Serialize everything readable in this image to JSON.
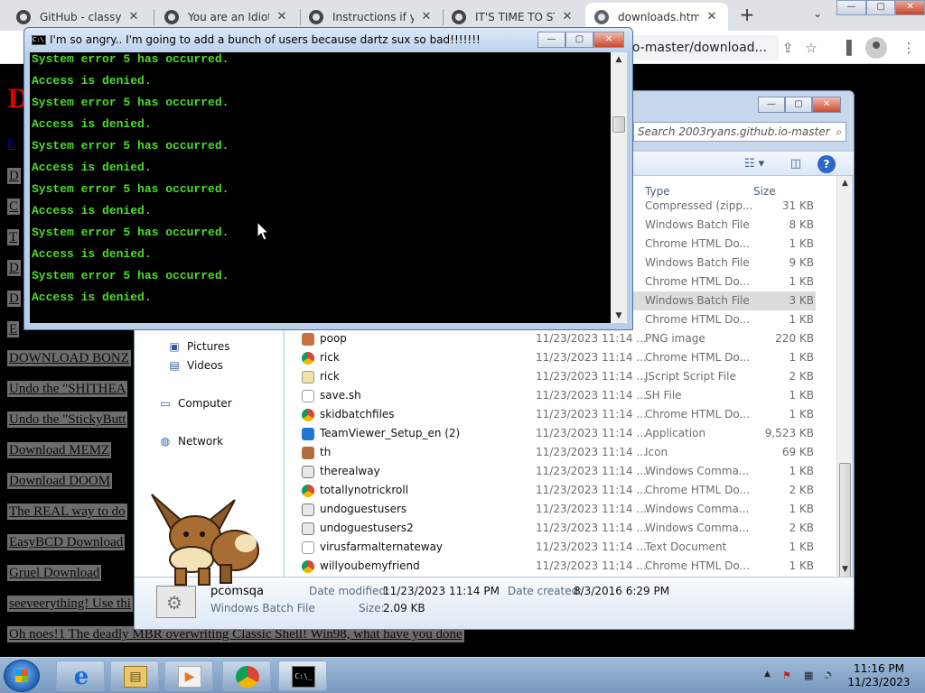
{
  "browser": {
    "tabs": [
      {
        "title": "GitHub - classyjak"
      },
      {
        "title": "You are an Idiot! ("
      },
      {
        "title": "Instructions if you"
      },
      {
        "title": "IT'S TIME TO STOP"
      },
      {
        "title": "downloads.html"
      }
    ],
    "new_tab": "+",
    "tab_search": "⌄",
    "url": "io-master/download...",
    "window_buttons": {
      "minimize": "—",
      "maximize": "▢",
      "close": "✕"
    }
  },
  "page": {
    "heading": "D",
    "small_link": "E",
    "links": [
      {
        "text": "D"
      },
      {
        "text": "C"
      },
      {
        "text": "T"
      },
      {
        "text": "D"
      },
      {
        "text": "D"
      },
      {
        "text": "E"
      },
      {
        "text": "DOWNLOAD BONZ"
      },
      {
        "text": "Undo the \"SHITHEA"
      },
      {
        "text": "Undo the \"StickyButt"
      },
      {
        "text": "Download MEMZ"
      },
      {
        "text": "Download DOOM"
      },
      {
        "text": "The REAL way to do"
      },
      {
        "text": "EasyBCD Download"
      },
      {
        "text": "Gruel Download"
      },
      {
        "text": "seeveerything! Use thi"
      },
      {
        "text": "Oh noes!1 The deadly MBR overwriting Classic Shell! Win98, what have you done"
      }
    ]
  },
  "explorer": {
    "search_placeholder": "Search 2003ryans.github.io-master",
    "columns": {
      "type": "Type",
      "size": "Size"
    },
    "nav": [
      {
        "label": "Pictures",
        "glyph": "▣"
      },
      {
        "label": "Videos",
        "glyph": "▤"
      },
      {
        "label": "Computer",
        "glyph": "▭"
      },
      {
        "label": "Network",
        "glyph": "◍"
      }
    ],
    "top_rows": [
      {
        "type": "Compressed (zipp...",
        "size": "31 KB",
        "icon": "ic-zip"
      },
      {
        "type": "Windows Batch File",
        "size": "8 KB",
        "icon": "ic-bat"
      },
      {
        "type": "Chrome HTML Do...",
        "size": "1 KB",
        "icon": "ic-chrome"
      },
      {
        "type": "Windows Batch File",
        "size": "9 KB",
        "icon": "ic-bat"
      },
      {
        "type": "Chrome HTML Do...",
        "size": "1 KB",
        "icon": "ic-chrome"
      },
      {
        "type": "Windows Batch File",
        "size": "3 KB",
        "icon": "ic-bat",
        "selected": true
      },
      {
        "type": "Chrome HTML Do...",
        "size": "1 KB",
        "icon": "ic-chrome"
      }
    ],
    "rows": [
      {
        "name": "poop",
        "date": "11/23/2023 11:14 ...",
        "type": "PNG image",
        "size": "220 KB",
        "icon": "ic-png"
      },
      {
        "name": "rick",
        "date": "11/23/2023 11:14 ...",
        "type": "Chrome HTML Do...",
        "size": "1 KB",
        "icon": "ic-chrome"
      },
      {
        "name": "rick",
        "date": "11/23/2023 11:14 ...",
        "type": "JScript Script File",
        "size": "2 KB",
        "icon": "ic-js"
      },
      {
        "name": "save.sh",
        "date": "11/23/2023 11:14 ...",
        "type": "SH File",
        "size": "1 KB",
        "icon": "ic-doc"
      },
      {
        "name": "skidbatchfiles",
        "date": "11/23/2023 11:14 ...",
        "type": "Chrome HTML Do...",
        "size": "1 KB",
        "icon": "ic-chrome"
      },
      {
        "name": "TeamViewer_Setup_en (2)",
        "date": "11/23/2023 11:14 ...",
        "type": "Application",
        "size": "9,523 KB",
        "icon": "ic-app"
      },
      {
        "name": "th",
        "date": "11/23/2023 11:14 ...",
        "type": "Icon",
        "size": "69 KB",
        "icon": "ic-ico"
      },
      {
        "name": "therealway",
        "date": "11/23/2023 11:14 ...",
        "type": "Windows Comma...",
        "size": "1 KB",
        "icon": "ic-cmd"
      },
      {
        "name": "totallynotrickroll",
        "date": "11/23/2023 11:14 ...",
        "type": "Chrome HTML Do...",
        "size": "2 KB",
        "icon": "ic-chrome"
      },
      {
        "name": "undoguestusers",
        "date": "11/23/2023 11:14 ...",
        "type": "Windows Comma...",
        "size": "1 KB",
        "icon": "ic-cmd"
      },
      {
        "name": "undoguestusers2",
        "date": "11/23/2023 11:14 ...",
        "type": "Windows Comma...",
        "size": "2 KB",
        "icon": "ic-cmd"
      },
      {
        "name": "virusfarmalternateway",
        "date": "11/23/2023 11:14 ...",
        "type": "Text Document",
        "size": "1 KB",
        "icon": "ic-doc"
      },
      {
        "name": "willyoubemyfriend",
        "date": "11/23/2023 11:14 ...",
        "type": "Chrome HTML Do...",
        "size": "1 KB",
        "icon": "ic-chrome"
      }
    ],
    "details": {
      "name": "pcomsqa",
      "type": "Windows Batch File",
      "modified_label": "Date modified:",
      "modified_value": "11/23/2023 11:14 PM",
      "created_label": "Date created:",
      "created_value": "8/3/2016 6:29 PM",
      "size_label": "Size:",
      "size_value": "2.09 KB"
    }
  },
  "cmd": {
    "icon_text": "C:\\",
    "title": "I'm so angry.. I'm going to add a bunch of users because dartz sux so bad!!!!!!!",
    "lines": [
      "System error 5 has occurred.",
      "Access is denied.",
      "System error 5 has occurred.",
      "Access is denied.",
      "System error 5 has occurred.",
      "Access is denied.",
      "System error 5 has occurred.",
      "Access is denied.",
      "System error 5 has occurred.",
      "Access is denied.",
      "System error 5 has occurred.",
      "Access is denied."
    ]
  },
  "taskbar": {
    "apps": [
      {
        "name": "internet-explorer",
        "glyph": "e"
      },
      {
        "name": "file-explorer",
        "glyph": "▤"
      },
      {
        "name": "media-player",
        "glyph": "▶"
      },
      {
        "name": "chrome",
        "glyph": ""
      },
      {
        "name": "command-prompt",
        "glyph": "C:\\_"
      }
    ],
    "tray": {
      "show_hidden": "▲",
      "flag": "⚑",
      "network": "▦",
      "volume": "🔈"
    },
    "time": "11:16 PM",
    "date": "11/23/2023"
  },
  "colors": {
    "console_text": "#4ade28",
    "link_bg": "#6d6d6d",
    "heading": "#dd0000"
  }
}
